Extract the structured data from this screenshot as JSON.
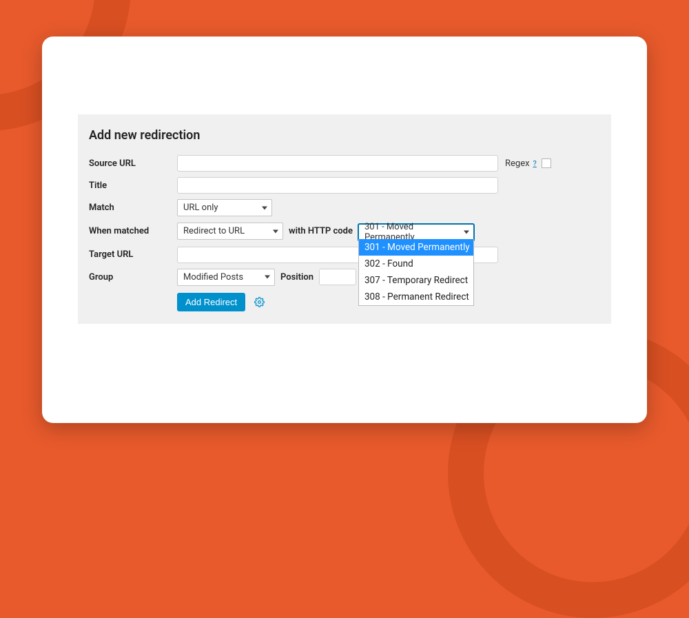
{
  "panel": {
    "title": "Add new redirection"
  },
  "fields": {
    "source_url": {
      "label": "Source URL",
      "value": ""
    },
    "title": {
      "label": "Title",
      "value": ""
    },
    "match": {
      "label": "Match",
      "selected": "URL only"
    },
    "when_matched": {
      "label": "When matched",
      "action_selected": "Redirect to URL",
      "with_label": "with HTTP code",
      "http_selected": "301 - Moved Permanently",
      "http_options": [
        "301 - Moved Permanently",
        "302 - Found",
        "307 - Temporary Redirect",
        "308 - Permanent Redirect"
      ]
    },
    "target_url": {
      "label": "Target URL",
      "value": ""
    },
    "group": {
      "label": "Group",
      "selected": "Modified Posts",
      "position_label": "Position",
      "position_value": ""
    }
  },
  "regex": {
    "label": "Regex",
    "help": "?"
  },
  "actions": {
    "add_redirect": "Add Redirect"
  }
}
